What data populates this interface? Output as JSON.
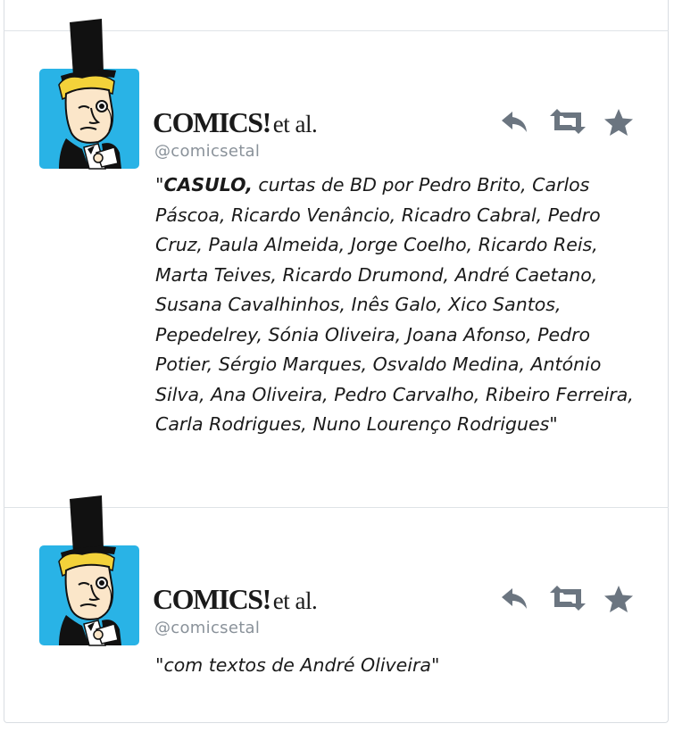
{
  "tweets": [
    {
      "author_name": "COMICS!",
      "author_name_suffix": "et al.",
      "author_handle": "@comicsetal",
      "text_open_quote": "\"",
      "text_bold": "CASULO,",
      "text_body": " curtas de BD por Pedro Brito, Carlos Páscoa, Ricardo Venâncio, Ricadro Cabral, Pedro Cruz, Paula Almeida, Jorge Coelho, Ricardo Reis, Marta Teives, Ricardo Drumond, André Caetano, Susana Cavalhinhos, Inês Galo, Xico Santos, Pepedelrey, Sónia Oliveira, Joana Afonso, Pedro Potier, Sérgio Marques, Osvaldo Medina, António Silva, Ana Oliveira, Pedro Carvalho, Ribeiro Ferreira, Carla Rodrigues, Nuno Lourenço Rodrigues",
      "text_close_quote": "\"",
      "actions": {
        "reply_icon": "reply-icon",
        "retweet_icon": "retweet-icon",
        "favorite_icon": "star-icon"
      }
    },
    {
      "author_name": "COMICS!",
      "author_name_suffix": "et al.",
      "author_handle": "@comicsetal",
      "text_open_quote": "\"",
      "text_body": "com textos de André Oliveira",
      "text_close_quote": "\"",
      "actions": {
        "reply_icon": "reply-icon",
        "retweet_icon": "retweet-icon",
        "favorite_icon": "star-icon"
      }
    }
  ],
  "colors": {
    "avatar_background": "#29b3e6",
    "action_icon": "#6b7580",
    "handle_text": "#8a929a",
    "divider": "#dfe3e7"
  }
}
